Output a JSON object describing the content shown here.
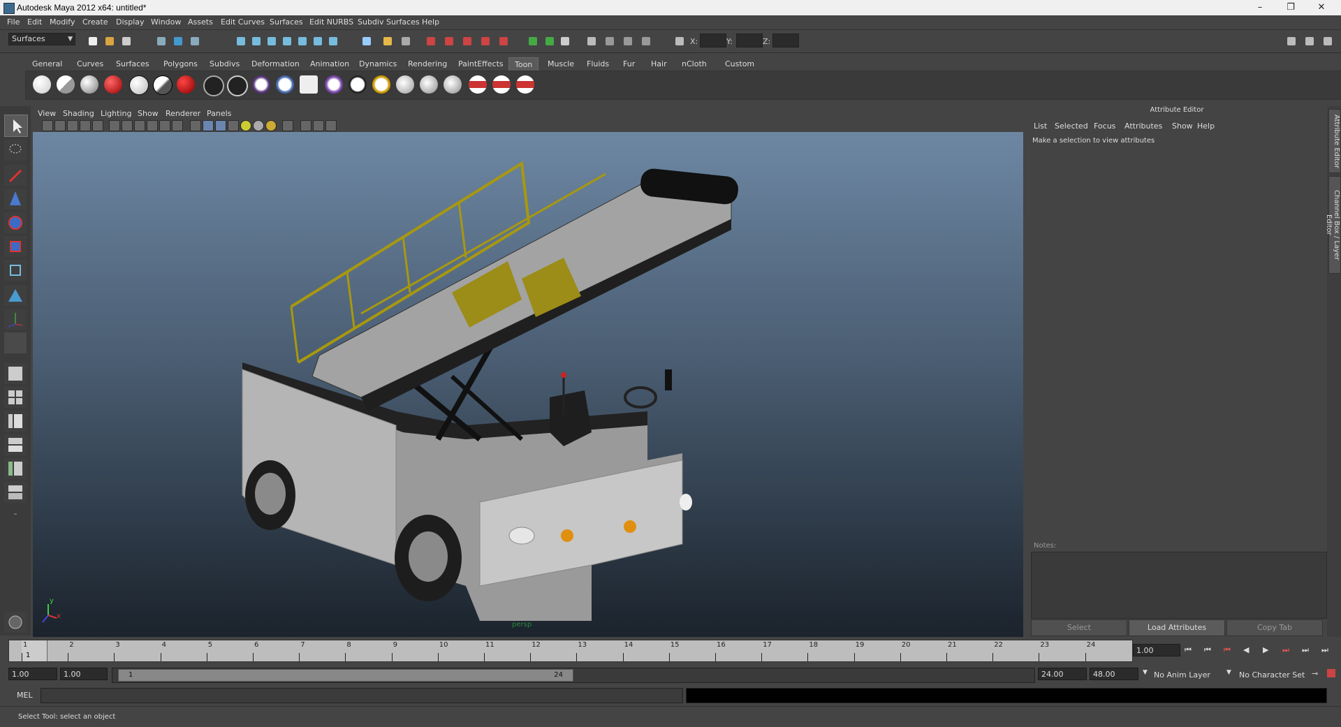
{
  "window": {
    "title": "Autodesk Maya 2012 x64: untitled*",
    "min": "–",
    "max": "❐",
    "close": "✕"
  },
  "menubar": [
    "File",
    "Edit",
    "Modify",
    "Create",
    "Display",
    "Window",
    "Assets",
    "Edit Curves",
    "Surfaces",
    "Edit NURBS",
    "Subdiv Surfaces",
    "Help"
  ],
  "status": {
    "menu_set": "Surfaces",
    "x_label": "X:",
    "y_label": "Y:",
    "z_label": "Z:"
  },
  "shelf": {
    "tabs": [
      "General",
      "Curves",
      "Surfaces",
      "Polygons",
      "Subdivs",
      "Deformation",
      "Animation",
      "Dynamics",
      "Rendering",
      "PaintEffects",
      "Toon",
      "Muscle",
      "Fluids",
      "Fur",
      "Hair",
      "nCloth",
      "Custom"
    ],
    "active_tab": "Toon"
  },
  "viewport": {
    "menu": [
      "View",
      "Shading",
      "Lighting",
      "Show",
      "Renderer",
      "Panels"
    ],
    "camera_label": "persp",
    "axis_y": "y",
    "axis_x": "x"
  },
  "attribute_editor": {
    "title": "Attribute Editor",
    "menu": [
      "List",
      "Selected",
      "Focus",
      "Attributes",
      "Show",
      "Help"
    ],
    "message": "Make a selection to view attributes",
    "notes_label": "Notes:",
    "buttons": {
      "select": "Select",
      "load": "Load Attributes",
      "copy": "Copy Tab"
    },
    "side_tabs": [
      "Attribute Editor",
      "Channel Box / Layer Editor"
    ]
  },
  "timeline": {
    "ticks": [
      "1",
      "2",
      "3",
      "4",
      "5",
      "6",
      "7",
      "8",
      "9",
      "10",
      "11",
      "12",
      "13",
      "14",
      "15",
      "16",
      "17",
      "18",
      "19",
      "20",
      "21",
      "22",
      "23",
      "24"
    ],
    "current_frame": "1",
    "current_field": "1.00"
  },
  "range": {
    "start": "1.00",
    "anim_start": "1.00",
    "slider_start": "1",
    "slider_end": "24",
    "anim_end": "24.00",
    "end": "48.00",
    "anim_layer": "No Anim Layer",
    "character_set": "No Character Set"
  },
  "command_line": {
    "label": "MEL"
  },
  "help_line": {
    "text": "Select Tool: select an object"
  }
}
